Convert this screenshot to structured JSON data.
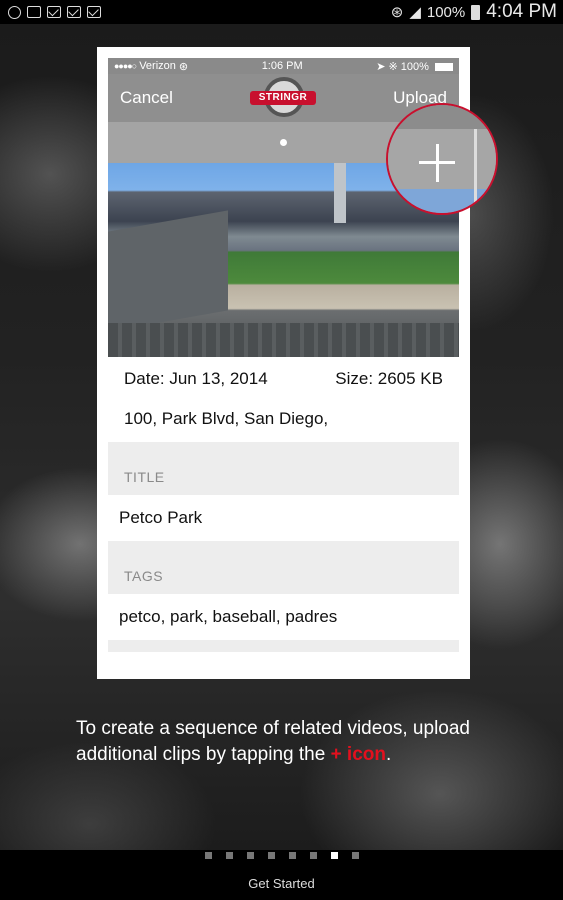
{
  "android_status": {
    "battery_percent": "100%",
    "time": "4:04 PM",
    "icons": [
      "hangouts-icon",
      "gallery-icon",
      "mail-icon",
      "gmail-icon",
      "mail-icon",
      "wifi-icon",
      "signal-icon",
      "battery-icon"
    ]
  },
  "ios_status": {
    "carrier": "Verizon",
    "time": "1:06 PM",
    "battery": "100%"
  },
  "nav": {
    "cancel_label": "Cancel",
    "logo_text": "STRINGR",
    "upload_label": "Upload"
  },
  "photo": {
    "subject": "baseball stadium"
  },
  "meta": {
    "date": "Date: Jun 13, 2014",
    "size": "Size: 2605 KB",
    "address": "100, Park Blvd, San Diego,"
  },
  "form": {
    "title_header": "TITLE",
    "title_value": "Petco Park",
    "tags_header": "TAGS",
    "tags_value": "petco, park, baseball, padres"
  },
  "caption": {
    "text": "To create a sequence of related videos, upload additional clips by tapping the ",
    "highlight": "+ icon",
    "end": ".",
    "accent_color": "#e3101e"
  },
  "pagination": {
    "total": 8,
    "current": 7
  },
  "cta_label": "Get Started"
}
